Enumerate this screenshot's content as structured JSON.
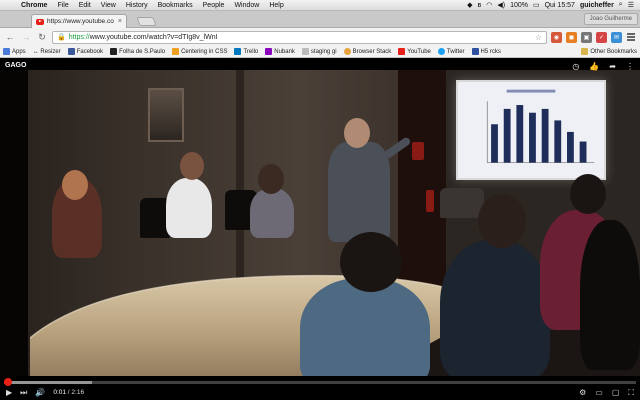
{
  "menubar": {
    "app_name": "Chrome",
    "items": [
      "File",
      "Edit",
      "View",
      "History",
      "Bookmarks",
      "People",
      "Window",
      "Help"
    ],
    "battery": "100%",
    "clock": "Qui 15:57",
    "user": "guicheffer"
  },
  "tab": {
    "title": "https://www.youtube.co",
    "close": "×"
  },
  "profile_name": "Joao Guilherme",
  "address_bar": {
    "scheme": "https://",
    "rest": "www.youtube.com/watch?v=dTIg8v_lWnI"
  },
  "bookmarks": {
    "items": [
      {
        "label": "Apps",
        "icon": "apps-grid-icon",
        "color": "#4a7bd8"
      },
      {
        "label": "↔ Resizer",
        "icon": "resizer-icon",
        "color": "#999999"
      },
      {
        "label": "Facebook",
        "icon": "facebook-icon",
        "color": "#3b5998"
      },
      {
        "label": "Folha de S.Paulo",
        "icon": "folha-icon",
        "color": "#222222"
      },
      {
        "label": "Centering in CSS",
        "icon": "css-star-icon",
        "color": "#f0a020"
      },
      {
        "label": "Trello",
        "icon": "trello-icon",
        "color": "#0079bf"
      },
      {
        "label": "Nubank",
        "icon": "nubank-icon",
        "color": "#8a05be"
      },
      {
        "label": "staging gi",
        "icon": "page-icon",
        "color": "#bbbbbb"
      },
      {
        "label": "Browser Stack",
        "icon": "browserstack-icon",
        "color": "#e6a23c"
      },
      {
        "label": "YouTube",
        "icon": "youtube-icon",
        "color": "#e62117"
      },
      {
        "label": "Twitter",
        "icon": "twitter-icon",
        "color": "#1da1f2"
      },
      {
        "label": "H5 rcks",
        "icon": "html5-icon",
        "color": "#2f4f9f"
      }
    ],
    "other": "Other Bookmarks"
  },
  "video": {
    "channel_title": "GAGO",
    "current_time": "0:01",
    "duration": "2:16",
    "played_fraction": 0.007,
    "buffered_fraction": 0.14
  },
  "colors": {
    "youtube_red": "#e62117",
    "secure_green": "#1a9b3a"
  }
}
